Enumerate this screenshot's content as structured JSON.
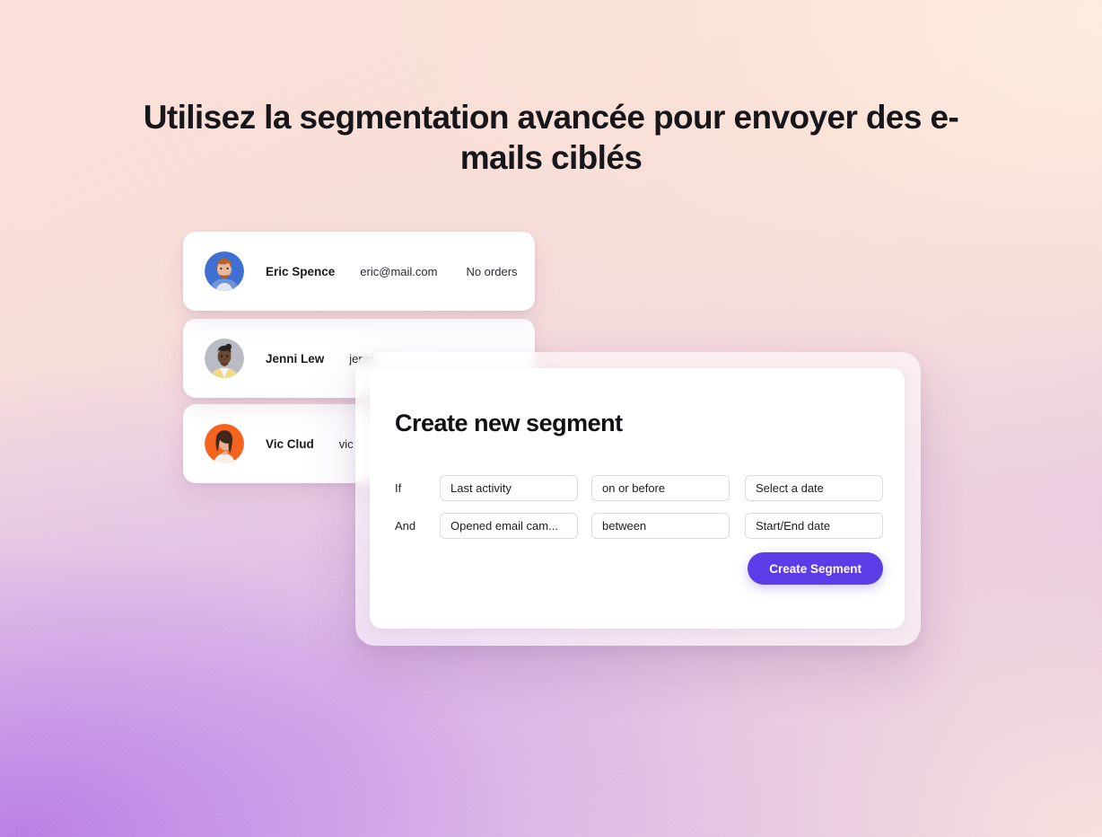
{
  "headline": "Utilisez la segmentation avancée pour envoyer des e-mails ciblés",
  "contacts": [
    {
      "name": "Eric Spence",
      "email": "eric@mail.com",
      "meta": "No orders",
      "avatar_name": "avatar-eric-spence",
      "avatar_bg": "#3f6fd0"
    },
    {
      "name": "Jenni Lew",
      "email": "jenni",
      "meta": "",
      "avatar_name": "avatar-jenni-lew",
      "avatar_bg": "#b9bcc4"
    },
    {
      "name": "Vic Clud",
      "email": "vic",
      "meta": "",
      "avatar_name": "avatar-vic-clud",
      "avatar_bg": "#f4641f"
    }
  ],
  "modal": {
    "title": "Create new segment",
    "rows": [
      {
        "label": "If",
        "condition": "Last activity",
        "operator": "on or before",
        "value": "Select a date"
      },
      {
        "label": "And",
        "condition": "Opened email cam...",
        "operator": "between",
        "value": "Start/End date"
      }
    ],
    "submit_label": "Create Segment",
    "accent_color": "#5b3ce6"
  }
}
